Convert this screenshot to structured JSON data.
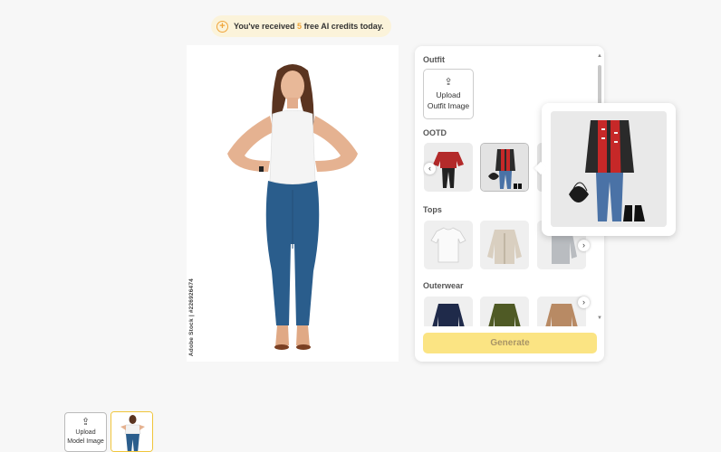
{
  "banner": {
    "prefix": "You've received",
    "count": "5",
    "suffix": "free AI credits today.",
    "icon": "plus-circle-icon"
  },
  "model_canvas": {
    "watermark": "Adobe Stock | #226926474"
  },
  "panel": {
    "outfit_title": "Outfit",
    "upload_outfit_label_1": "Upload",
    "upload_outfit_label_2": "Outfit Image",
    "ootd_title": "OOTD",
    "tops_title": "Tops",
    "outerwear_title": "Outerwear",
    "generate_label": "Generate"
  },
  "bottom": {
    "upload_model_label_1": "Upload",
    "upload_model_label_2": "Model Image"
  },
  "colors": {
    "accent": "#f0a53a",
    "generate_bg": "#fbe483",
    "selected_border": "#f0c53a"
  }
}
